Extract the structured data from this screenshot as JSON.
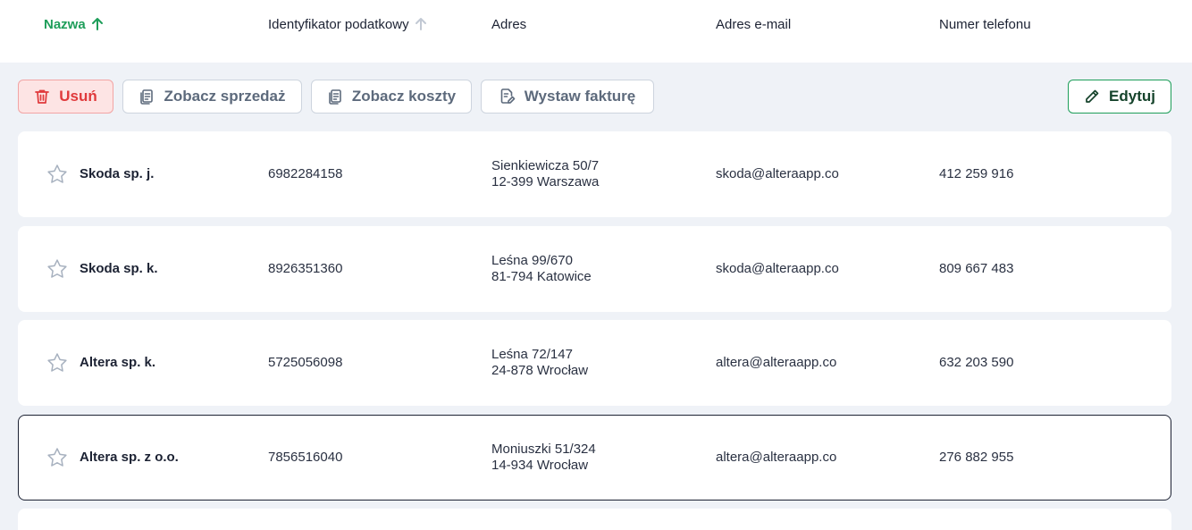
{
  "columns": {
    "name": "Nazwa",
    "tax_id": "Identyfikator podatkowy",
    "address": "Adres",
    "email": "Adres e-mail",
    "phone": "Numer telefonu"
  },
  "toolbar": {
    "delete_label": "Usuń",
    "view_sales_label": "Zobacz sprzedaż",
    "view_costs_label": "Zobacz koszty",
    "invoice_label": "Wystaw fakturę",
    "edit_label": "Edytuj"
  },
  "rows": [
    {
      "name": "Skoda sp. j.",
      "tax_id": "6982284158",
      "street": "Sienkiewicza 50/7",
      "city": "12-399 Warszawa",
      "email": "skoda@alteraapp.co",
      "phone": "412 259 916",
      "selected": false
    },
    {
      "name": "Skoda sp. k.",
      "tax_id": "8926351360",
      "street": "Leśna 99/670",
      "city": "81-794 Katowice",
      "email": "skoda@alteraapp.co",
      "phone": "809 667 483",
      "selected": false
    },
    {
      "name": "Altera sp. k.",
      "tax_id": "5725056098",
      "street": "Leśna 72/147",
      "city": "24-878 Wrocław",
      "email": "altera@alteraapp.co",
      "phone": "632 203 590",
      "selected": false
    },
    {
      "name": "Altera sp. z o.o.",
      "tax_id": "7856516040",
      "street": "Moniuszki 51/324",
      "city": "14-934 Wrocław",
      "email": "altera@alteraapp.co",
      "phone": "276 882 955",
      "selected": true
    }
  ],
  "colors": {
    "accent": "#1e9e5a",
    "danger": "#e0393b",
    "background": "#eff2f7"
  }
}
